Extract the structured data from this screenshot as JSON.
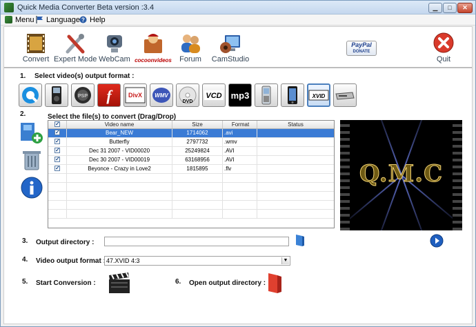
{
  "window": {
    "title": "Quick Media Converter  Beta version :3.4",
    "controls": [
      "minimize-icon",
      "maximize-icon",
      "close-icon"
    ]
  },
  "menu": {
    "items": [
      {
        "label": "Menu",
        "icon": "app-icon"
      },
      {
        "label": "Languages",
        "icon": "flag-icon"
      },
      {
        "label": "Help",
        "icon": "help-icon"
      }
    ]
  },
  "toolbar": {
    "convert": "Convert",
    "expert_mode": "Expert Mode",
    "webcam": "WebCam",
    "cocoon": "cocoonvideos",
    "forum": "Forum",
    "camstudio": "CamStudio",
    "paypal_top": "PayPal",
    "paypal_bottom": "DONATE",
    "quit": "Quit"
  },
  "steps": {
    "s1_num": "1.",
    "s1_label": "Select video(s) output format :",
    "s2_num": "2.",
    "s2_label": "Select  the  file(s) to convert (Drag/Drop)",
    "s3_num": "3.",
    "s3_label": "Output directory :",
    "s4_num": "4.",
    "s4_label": "Video output format :",
    "s5_num": "5.",
    "s5_label": "Start Conversion :",
    "s6_num": "6.",
    "s6_label": "Open output directory :"
  },
  "formats": {
    "icons": [
      "quicktime-icon",
      "ipod-icon",
      "psp-icon",
      "flash-icon",
      "divx-icon",
      "wmv-icon",
      "dvd-icon",
      "vcd-icon",
      "mp3-icon",
      "mobile-icon",
      "iphone-icon",
      "xvid-icon",
      "device-icon"
    ],
    "divx": "DivX",
    "wmv": "WMV",
    "dvd": "DVD",
    "vcd": "VCD",
    "mp3": "mp3",
    "xvid": "XVID",
    "selected": "xvid"
  },
  "table": {
    "headers": [
      "Video name",
      "Size",
      "Format",
      "Status"
    ],
    "rows": [
      {
        "name": "Bear_NEW",
        "size": "1714062",
        "format": ".avi",
        "status": ""
      },
      {
        "name": "Butterfly",
        "size": "2797732",
        "format": ".wmv",
        "status": ""
      },
      {
        "name": "Dec 31 2007 - VID00020",
        "size": "25249824",
        "format": ".AVI",
        "status": ""
      },
      {
        "name": "Dec 30 2007 - VID00019",
        "size": "63168956",
        "format": ".AVI",
        "status": ""
      },
      {
        "name": "Beyonce - Crazy in Love2",
        "size": "1815895",
        "format": ".flv",
        "status": ""
      }
    ],
    "selected_row": 0
  },
  "preview": {
    "text": "Q.M.C"
  },
  "output": {
    "directory_value": "",
    "format_value": "47.XVID 4:3"
  },
  "colors": {
    "selection": "#3a7bd5",
    "title_gradient_top": "#dce9f7",
    "quit_red": "#d93a2b"
  }
}
